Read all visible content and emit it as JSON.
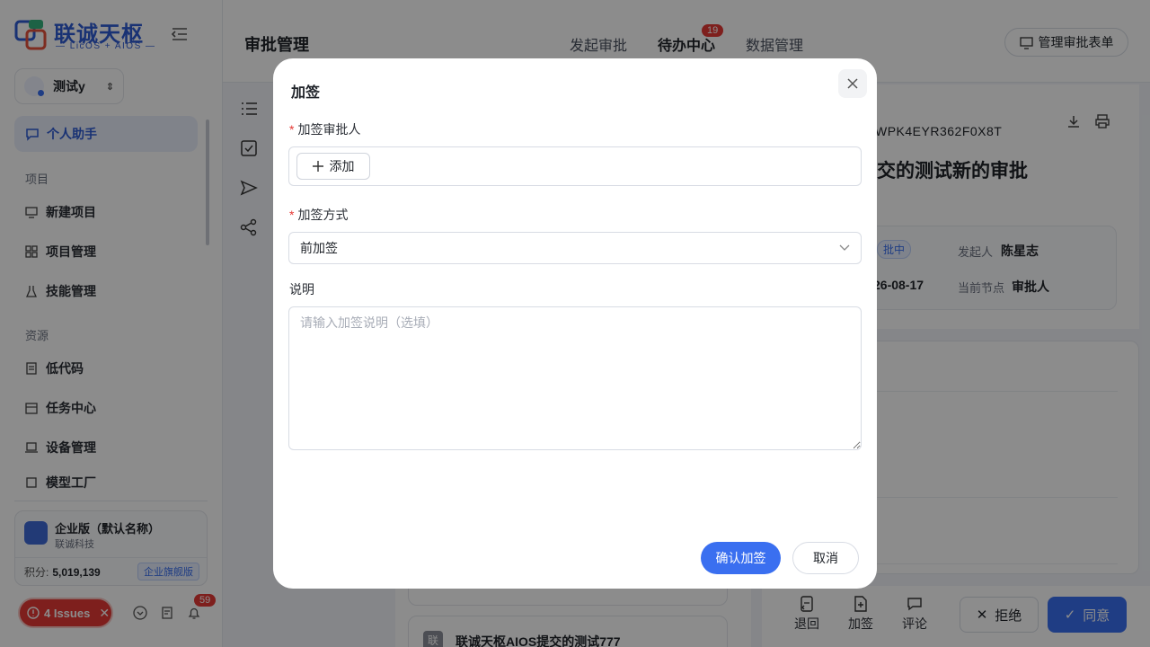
{
  "brand": {
    "name": "联诚天枢",
    "tagline": "— LicOS + AIOS —"
  },
  "tenant": {
    "name": "测试y"
  },
  "sidebar": {
    "active_item": "个人助手",
    "groups": [
      {
        "title": "项目",
        "items": [
          "新建项目",
          "项目管理",
          "技能管理"
        ]
      },
      {
        "title": "资源",
        "items": [
          "低代码",
          "任务中心",
          "设备管理",
          "模型工厂"
        ]
      }
    ],
    "org": {
      "name": "企业版（默认名称）",
      "company": "联诚科技",
      "points_label": "积分:",
      "points_value": "5,019,139",
      "plan": "企业旗舰版"
    },
    "issues_label": "4 Issues",
    "notification_count": "59"
  },
  "header": {
    "title": "审批管理",
    "tabs": [
      "发起审批",
      "待办中心",
      "数据管理"
    ],
    "active_tab": "待办中心",
    "todo_badge": "19",
    "manage_button": "管理审批表单"
  },
  "detail": {
    "id_fragment": "WPK4EYR362F0X8T",
    "title_fragment": "交的测试新的审批",
    "status_fragment": "批中",
    "initiator_label": "发起人",
    "initiator_value": "陈星志",
    "date_fragment": "26-08-17",
    "node_label": "当前节点",
    "node_value": "审批人"
  },
  "list": {
    "card_title": "联诚天枢AIOS提交的测试777",
    "card_logo": "联"
  },
  "actions": {
    "return": "退回",
    "add_sign": "加签",
    "comment": "评论",
    "reject": "拒绝",
    "agree": "同意"
  },
  "modal": {
    "title": "加签",
    "approver_label": "加签审批人",
    "add_button": "添加",
    "method_label": "加签方式",
    "method_value": "前加签",
    "desc_label": "说明",
    "desc_placeholder": "请输入加签说明（选填）",
    "confirm_button": "确认加签",
    "cancel_button": "取消"
  },
  "colors": {
    "primary": "#3a6ff0",
    "danger": "#e53935",
    "brand": "#2f5bd3"
  }
}
